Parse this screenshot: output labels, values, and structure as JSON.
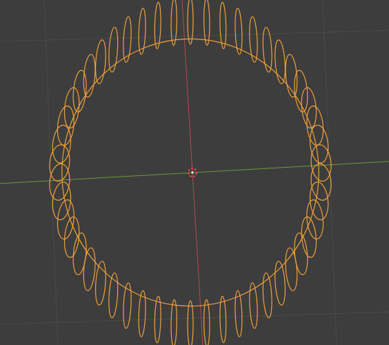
{
  "viewport": {
    "background": "#3d3d3d",
    "grid_color": "#4a4a4a",
    "x_axis_color": "#6f9a3a",
    "y_axis_color": "#b54a55",
    "selection_color": "#f4a23a",
    "origin_color": "#f2f2f2",
    "grid": "on",
    "view": "perspective",
    "object": {
      "ring_loops": 50,
      "state": "selected"
    },
    "origin_marker": "3d-cursor-icon"
  }
}
